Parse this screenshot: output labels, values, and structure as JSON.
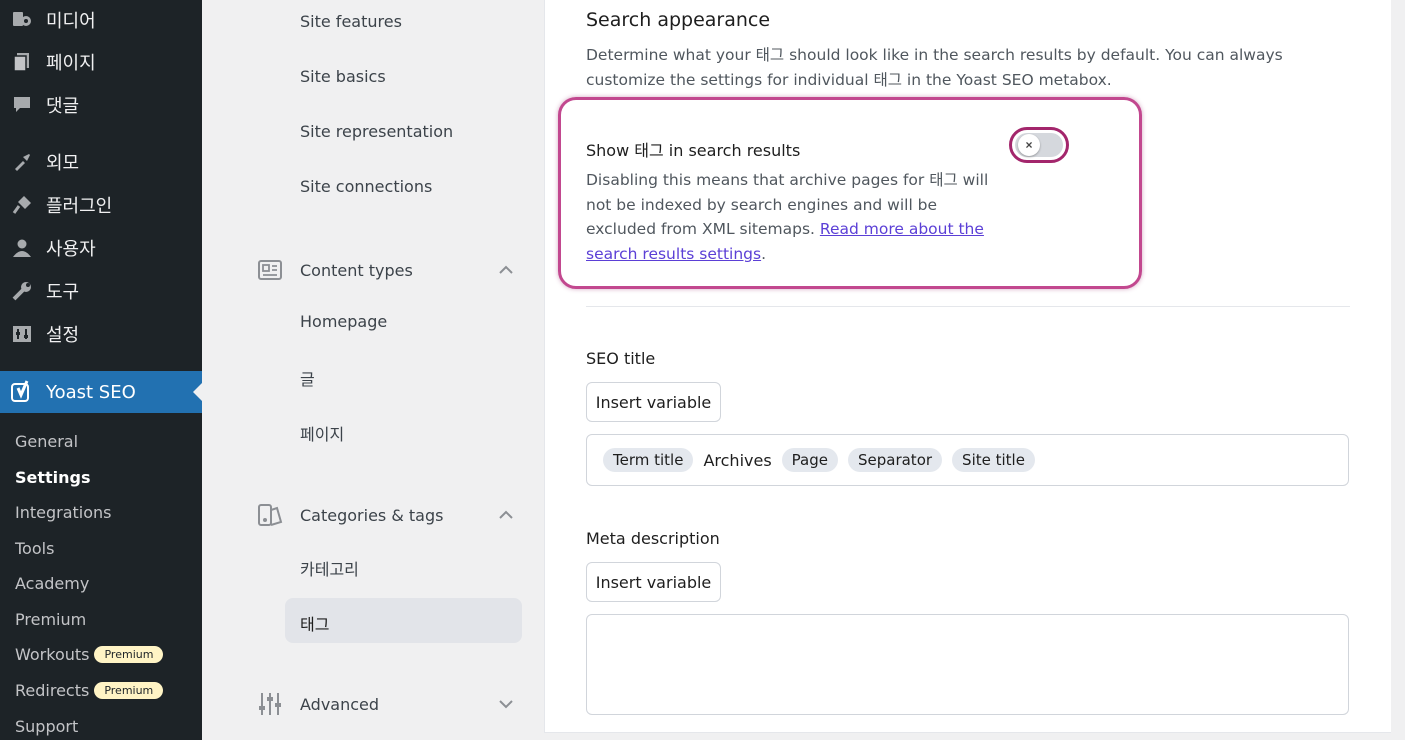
{
  "wp_menu": {
    "items": [
      {
        "label": "미디어",
        "icon": "media-icon"
      },
      {
        "label": "페이지",
        "icon": "pages-icon"
      },
      {
        "label": "댓글",
        "icon": "comments-icon"
      },
      {
        "label": "외모",
        "icon": "appearance-icon"
      },
      {
        "label": "플러그인",
        "icon": "plugins-icon"
      },
      {
        "label": "사용자",
        "icon": "users-icon"
      },
      {
        "label": "도구",
        "icon": "tools-icon"
      },
      {
        "label": "설정",
        "icon": "settings-icon"
      }
    ],
    "yoast": {
      "label": "Yoast SEO",
      "icon": "yoast-icon"
    },
    "submenu": [
      {
        "label": "General"
      },
      {
        "label": "Settings"
      },
      {
        "label": "Integrations"
      },
      {
        "label": "Tools"
      },
      {
        "label": "Academy"
      },
      {
        "label": "Premium"
      },
      {
        "label": "Workouts",
        "badge": "Premium"
      },
      {
        "label": "Redirects",
        "badge": "Premium"
      },
      {
        "label": "Support"
      }
    ],
    "active_submenu": "Settings"
  },
  "settings_nav": {
    "site_items": [
      "Site features",
      "Site basics",
      "Site representation",
      "Site connections"
    ],
    "content_types": {
      "label": "Content types",
      "items": [
        "Homepage",
        "글",
        "페이지"
      ]
    },
    "categories_tags": {
      "label": "Categories & tags",
      "items": [
        "카테고리",
        "태그"
      ],
      "active": "태그"
    },
    "advanced": {
      "label": "Advanced"
    }
  },
  "main": {
    "section_title": "Search appearance",
    "section_desc": "Determine what your 태그 should look like in the search results by default. You can always customize the settings for individual 태그 in the Yoast SEO metabox.",
    "toggle": {
      "label": "Show 태그 in search results",
      "desc_text": "Disabling this means that archive pages for 태그 will not be indexed by search engines and will be excluded from XML sitemaps. ",
      "link_text": "Read more about the search results settings",
      "desc_end": ".",
      "state": "off",
      "knob_glyph": "×"
    },
    "seo_title": {
      "label": "SEO title",
      "button": "Insert variable",
      "tokens": [
        {
          "text": "Term title",
          "pill": true
        },
        {
          "text": "Archives",
          "pill": false
        },
        {
          "text": "Page",
          "pill": true
        },
        {
          "text": "Separator",
          "pill": true
        },
        {
          "text": "Site title",
          "pill": true
        }
      ]
    },
    "meta_description": {
      "label": "Meta description",
      "button": "Insert variable",
      "value": ""
    }
  },
  "colors": {
    "wp_sidebar": "#1d2327",
    "yoast_active": "#2271b1",
    "highlight": "#c2488f",
    "link": "#5b3fd6",
    "premium_badge": "#fff4c5"
  }
}
